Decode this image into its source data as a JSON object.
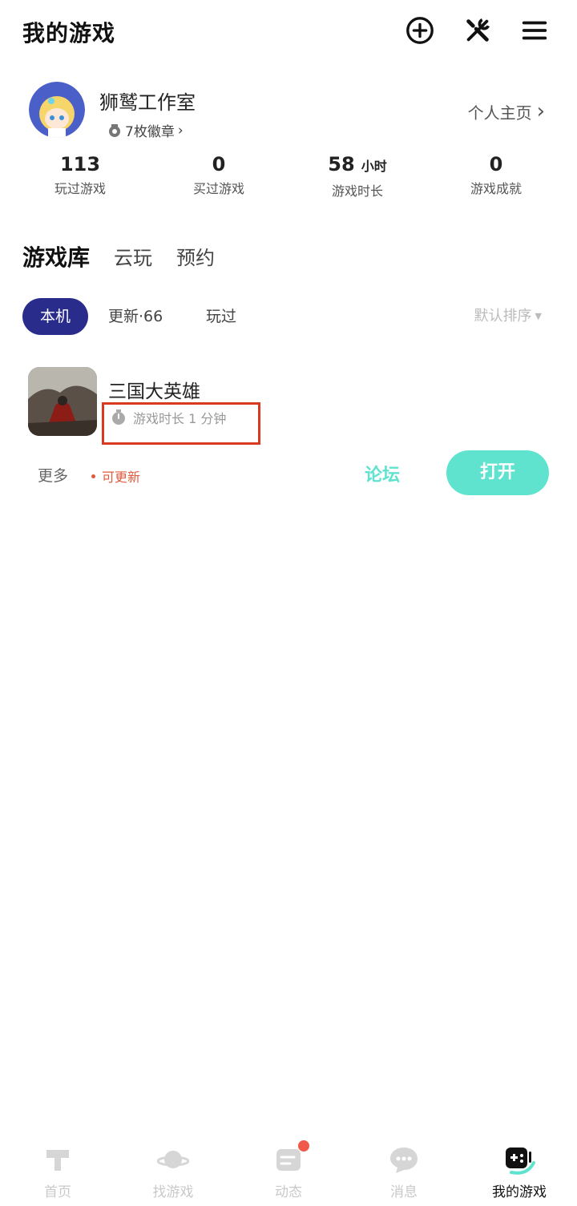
{
  "header": {
    "title": "我的游戏",
    "icons": [
      "add-circle-icon",
      "tools-icon",
      "menu-icon"
    ]
  },
  "profile": {
    "name": "狮鹫工作室",
    "badges": "7枚徽章",
    "profile_link": "个人主页"
  },
  "stats": [
    {
      "value": "113",
      "unit": "",
      "label": "玩过游戏"
    },
    {
      "value": "0",
      "unit": "",
      "label": "买过游戏"
    },
    {
      "value": "58",
      "unit": "小时",
      "label": "游戏时长"
    },
    {
      "value": "0",
      "unit": "",
      "label": "游戏成就"
    }
  ],
  "library_tabs": [
    {
      "label": "游戏库",
      "active": true
    },
    {
      "label": "云玩",
      "active": false
    },
    {
      "label": "预约",
      "active": false
    }
  ],
  "filters": {
    "chips": [
      {
        "label": "本机",
        "active": true
      },
      {
        "label": "更新·66",
        "active": false
      },
      {
        "label": "玩过",
        "active": false
      }
    ],
    "sort": "默认排序"
  },
  "game": {
    "name": "三国大英雄",
    "playtime": "游戏时长 1 分钟",
    "more": "更多",
    "update_tag": "可更新",
    "forum": "论坛",
    "open": "打开"
  },
  "tabbar": [
    {
      "label": "首页",
      "icon": "home-icon",
      "active": false
    },
    {
      "label": "找游戏",
      "icon": "planet-icon",
      "active": false
    },
    {
      "label": "动态",
      "icon": "feed-icon",
      "active": false,
      "dot": true
    },
    {
      "label": "消息",
      "icon": "chat-icon",
      "active": false
    },
    {
      "label": "我的游戏",
      "icon": "gamepad-icon",
      "active": true
    }
  ],
  "colors": {
    "accent": "#5fe3cf",
    "primary": "#2a2c8c",
    "highlight": "#d9391f",
    "update": "#e2593e"
  }
}
